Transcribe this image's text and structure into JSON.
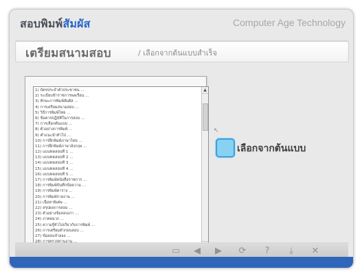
{
  "app": {
    "brand_prefix": "สอบพิมพ์",
    "brand_suffix": "สัมผัส",
    "tagline": "Computer Age Technology"
  },
  "page": {
    "title": "เตรียมสนามสอบ",
    "subtitle": "/ เลือกจากต้นแบบสำเร็จ"
  },
  "lesson_list": {
    "items": [
      "1) บัตรประจำตัวประชาชน ...",
      "2) ระเบียบข้าราชการพลเรือน ...",
      "3) ทักษะการพิมพ์สัมผัส ...",
      "4) การเตรียมสนามสอบ ...",
      "5) วิธีการพิมพ์ไทย ...",
      "6) ข้อควรปฏิบัติในการสอบ ...",
      "7) การเลือกต้นแบบ ...",
      "8) ตัวอย่างการพิมพ์ ...",
      "9) คำแนะนำทั่วไป ...",
      "10) การฝึกพิมพ์ภาษาไทย ...",
      "11) การฝึกพิมพ์ภาษาอังกฤษ ...",
      "12) แบบทดสอบที่ 1 ...",
      "13) แบบทดสอบที่ 2 ...",
      "14) แบบทดสอบที่ 3 ...",
      "15) แบบทดสอบที่ 4 ...",
      "16) แบบทดสอบที่ 5 ...",
      "17) การพิมพ์หนังสือราชการ ...",
      "18) การพิมพ์บันทึกข้อความ ...",
      "19) การพิมพ์ตาราง ...",
      "20) การพิมพ์รายงาน ...",
      "21) เนื้อหาพิเศษ ...",
      "22) สรุปผลการสอบ ...",
      "23) ตัวอย่างข้อสอบเก่า ...",
      "24) ภาคผนวก ...",
      "25) ความรู้ทั่วไปเกี่ยวกับการพิมพ์ ...",
      "26) การเตรียมตัวก่อนสอบ ...",
      "27) ข้อสอบจำลอง ...",
      "28) การตรวจทานงาน ..."
    ],
    "scroll_up": "▲",
    "scroll_down": "▼"
  },
  "choose_action": {
    "label": "เลือกจากต้นแบบ"
  },
  "cursor_glyph": "↖",
  "toolbar": {
    "save_icon": "▭",
    "prev_icon": "◀",
    "next_icon": "▶",
    "refresh_icon": "⟳",
    "help_icon": "?",
    "minimize_icon": "⤓",
    "close_icon": "✕"
  },
  "colors": {
    "accent_blue": "#2564c8",
    "frame_bottom": "#2f66b9",
    "choose_fill": "#87d1f3"
  }
}
